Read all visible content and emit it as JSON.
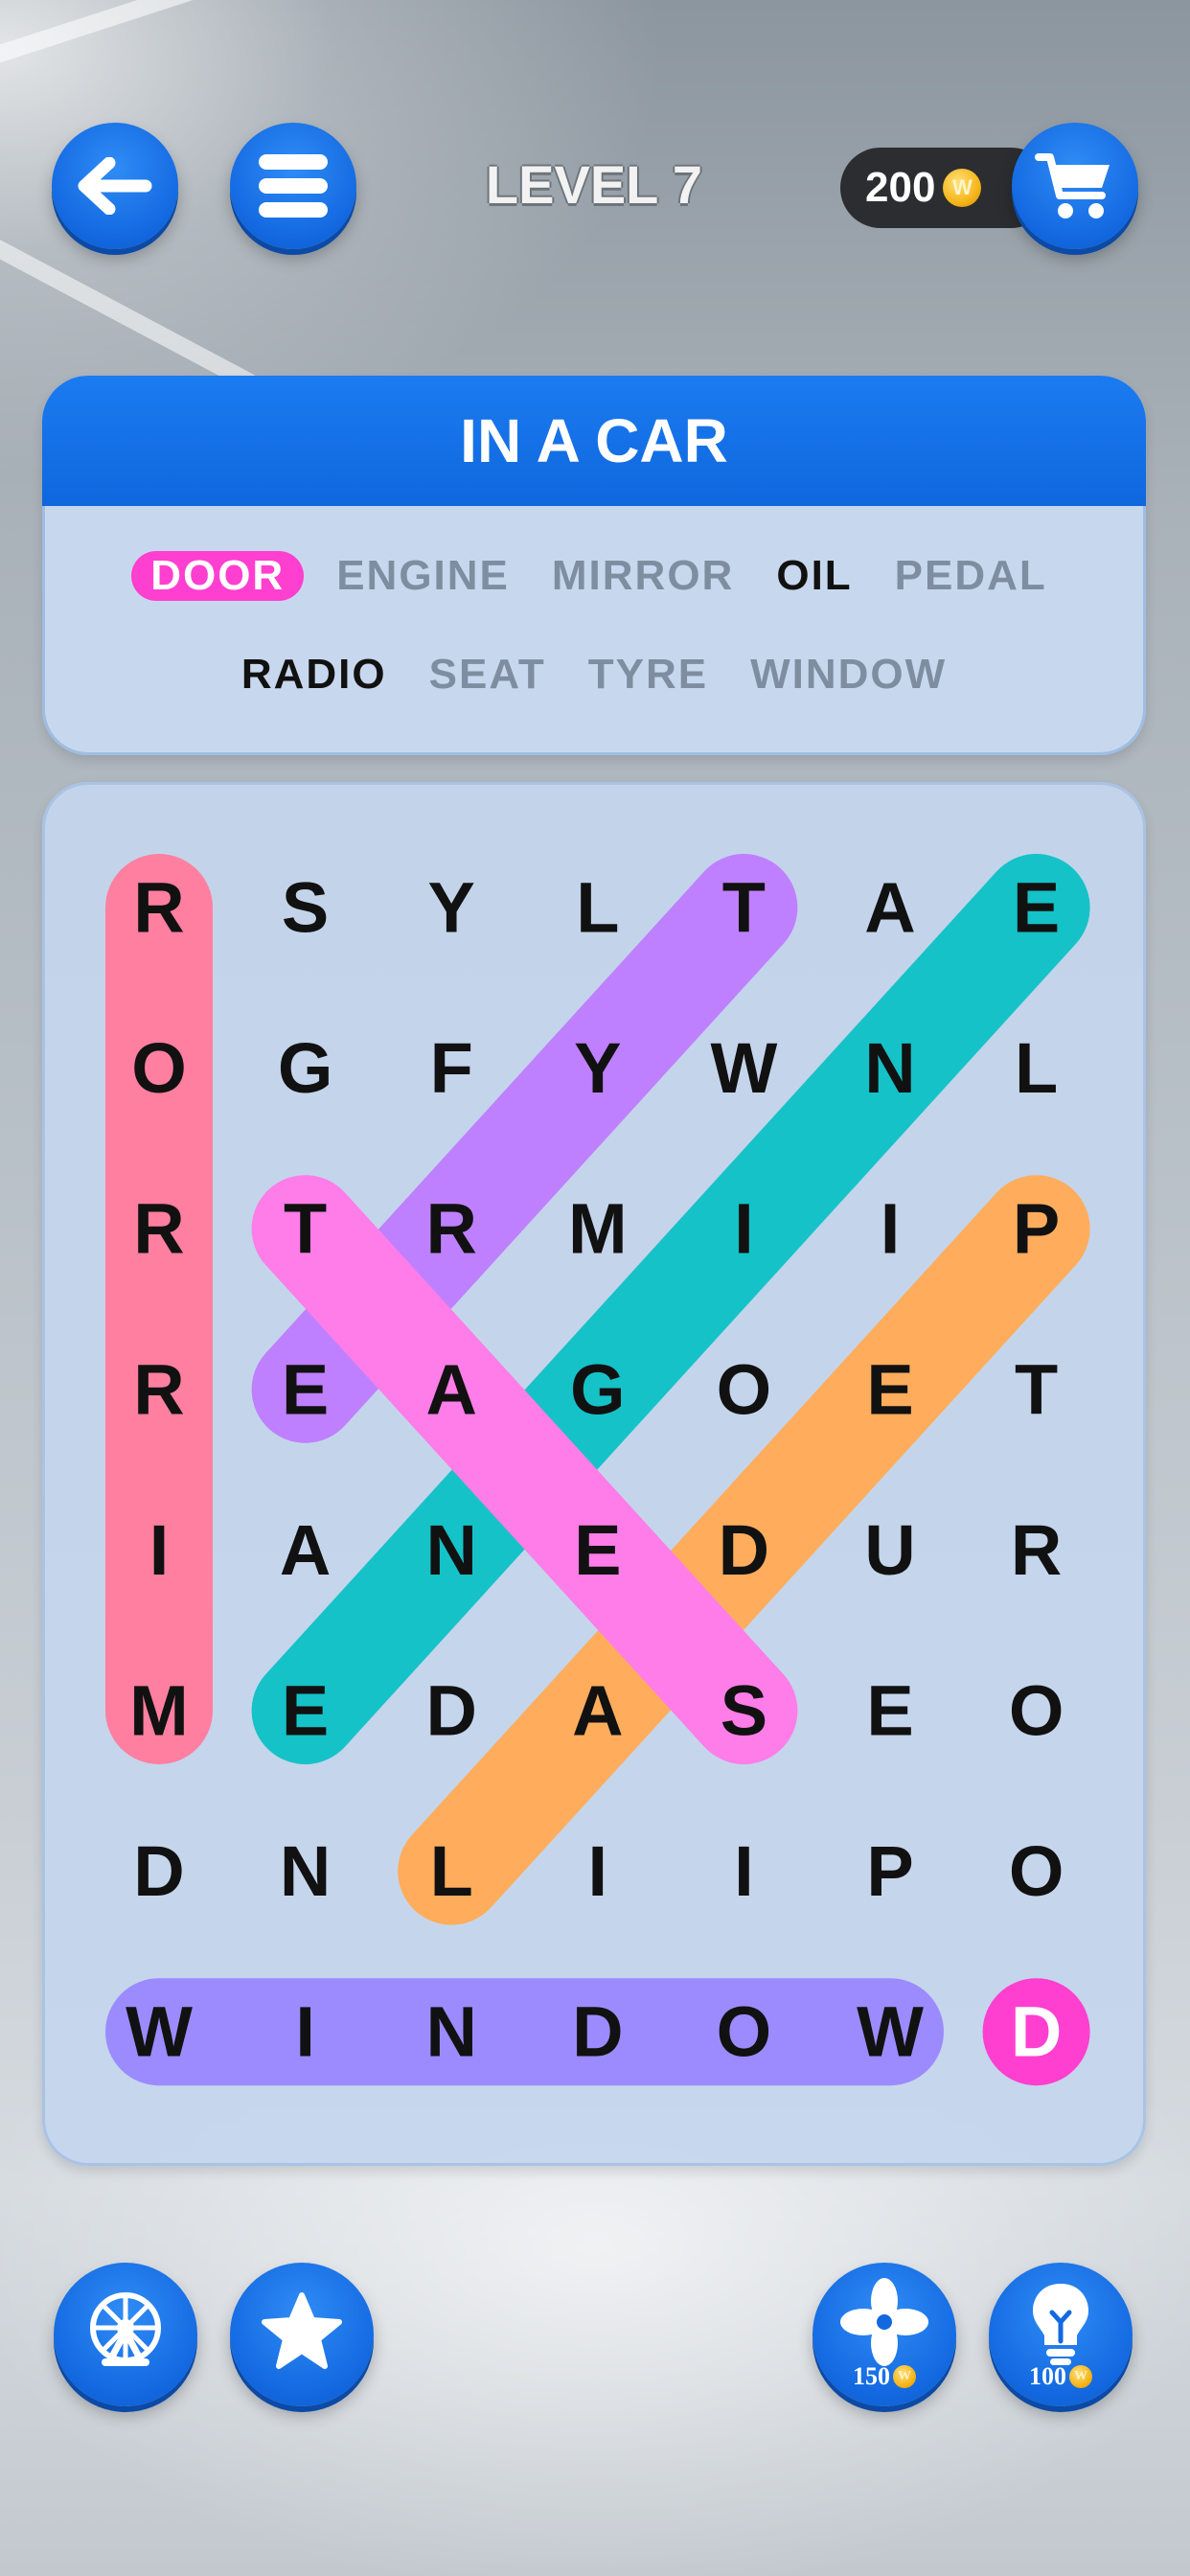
{
  "header": {
    "back_icon": "arrow-left-icon",
    "menu_icon": "hamburger-menu-icon",
    "level_title": "LEVEL 7",
    "coins": "200",
    "coin_symbol": "W",
    "shop_icon": "shopping-cart-icon"
  },
  "words_panel": {
    "category": "IN A CAR",
    "rows": [
      [
        {
          "text": "DOOR",
          "state": "active"
        },
        {
          "text": "ENGINE",
          "state": "todo"
        },
        {
          "text": "MIRROR",
          "state": "todo"
        },
        {
          "text": "OIL",
          "state": "found"
        },
        {
          "text": "PEDAL",
          "state": "todo"
        }
      ],
      [
        {
          "text": "RADIO",
          "state": "found"
        },
        {
          "text": "SEAT",
          "state": "todo"
        },
        {
          "text": "TYRE",
          "state": "todo"
        },
        {
          "text": "WINDOW",
          "state": "todo"
        }
      ]
    ]
  },
  "grid": {
    "rows": [
      [
        "R",
        "S",
        "Y",
        "L",
        "T",
        "A",
        "E"
      ],
      [
        "O",
        "G",
        "F",
        "Y",
        "W",
        "N",
        "L"
      ],
      [
        "R",
        "T",
        "R",
        "M",
        "I",
        "I",
        "P"
      ],
      [
        "R",
        "E",
        "A",
        "G",
        "O",
        "E",
        "T"
      ],
      [
        "I",
        "A",
        "N",
        "E",
        "D",
        "U",
        "R"
      ],
      [
        "M",
        "E",
        "D",
        "A",
        "S",
        "E",
        "O"
      ],
      [
        "D",
        "N",
        "L",
        "I",
        "I",
        "P",
        "O"
      ],
      [
        "W",
        "I",
        "N",
        "D",
        "O",
        "W",
        "D"
      ]
    ],
    "highlights": [
      {
        "from": [
          0,
          0
        ],
        "to": [
          5,
          0
        ],
        "color": "#ff7fa0"
      },
      {
        "from": [
          0,
          4
        ],
        "to": [
          3,
          1
        ],
        "color": "#bf80ff"
      },
      {
        "from": [
          0,
          6
        ],
        "to": [
          5,
          1
        ],
        "color": "#15c2c8"
      },
      {
        "from": [
          2,
          6
        ],
        "to": [
          6,
          2
        ],
        "color": "#ffad5c"
      },
      {
        "from": [
          2,
          1
        ],
        "to": [
          5,
          4
        ],
        "color": "#ff7de8"
      },
      {
        "from": [
          7,
          0
        ],
        "to": [
          7,
          5
        ],
        "color": "#9b8bff"
      },
      {
        "from": [
          7,
          6
        ],
        "to": [
          7,
          6
        ],
        "color": "#ff3fcf"
      }
    ],
    "white_cells": [
      [
        7,
        6
      ]
    ]
  },
  "bottom": {
    "left_buttons": [
      "ferris-wheel-icon",
      "star-icon"
    ],
    "shuffle_icon": "fan-shuffle-icon",
    "shuffle_cost": "150",
    "hint_icon": "lightbulb-icon",
    "hint_cost": "100"
  },
  "colors": {
    "primary_blue": "#1368e0",
    "panel_bg": "#c7d8ee",
    "active_word": "#ff3fcf"
  }
}
